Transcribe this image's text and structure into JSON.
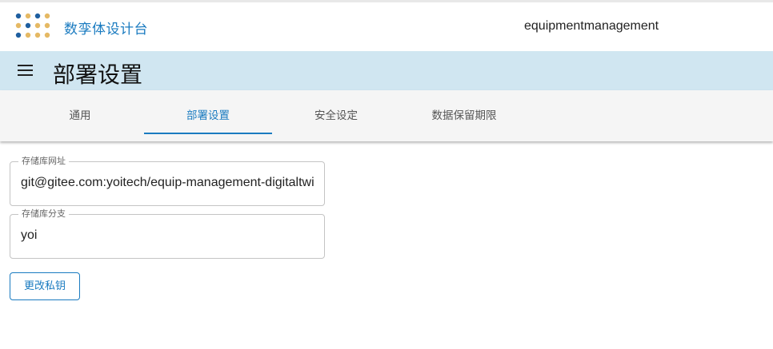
{
  "header": {
    "app_title": "数孪体设计台",
    "project_name": "equipmentmanagement",
    "logo_icon": "dots-grid-logo",
    "colors": {
      "logo_blue": "#1f5fa0",
      "logo_gold": "#e5b964",
      "brand": "#1a7bc0"
    }
  },
  "titlebar": {
    "page_title": "部署设置",
    "menu_icon": "hamburger-menu-icon",
    "background": "#d0e6f1"
  },
  "tabs": {
    "items": [
      {
        "label": "通用"
      },
      {
        "label": "部署设置"
      },
      {
        "label": "安全设定"
      },
      {
        "label": "数据保留期限"
      }
    ],
    "active": "部署设置"
  },
  "form": {
    "repo_url": {
      "label": "存储库网址",
      "value": "git@gitee.com:yoitech/equip-management-digitaltwi"
    },
    "repo_branch": {
      "label": "存储库分支",
      "value": "yoi"
    },
    "change_key_button": "更改私钥"
  }
}
